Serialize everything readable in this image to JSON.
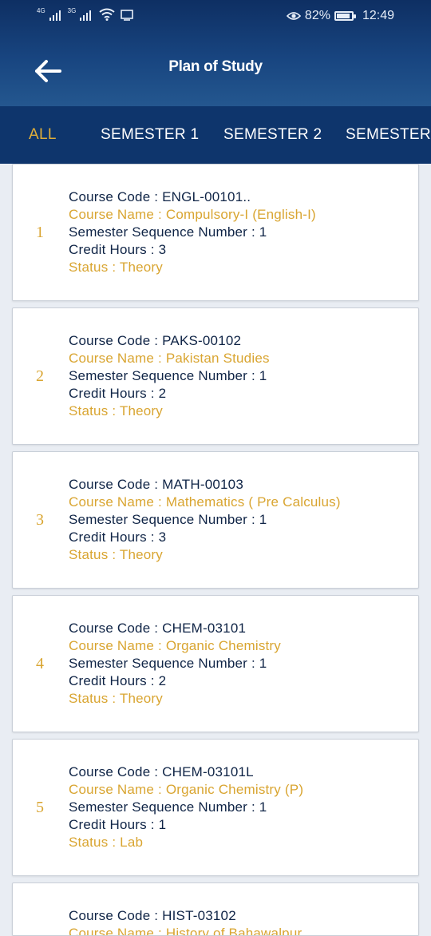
{
  "status_bar": {
    "net1": "4G",
    "net2": "3G",
    "battery": "82%",
    "time": "12:49"
  },
  "header": {
    "title": "Plan of Study"
  },
  "tabs": [
    "ALL",
    "SEMESTER 1",
    "SEMESTER 2",
    "SEMESTER"
  ],
  "colors": {
    "header": "#184580",
    "tabs": "#0e356c",
    "accent": "#d9a531",
    "text": "#0f2446"
  },
  "courses": [
    {
      "index": "1",
      "code": "Course Code : ENGL-00101..",
      "name": "Course Name : Compulsory-I (English-I)",
      "seq": "Semester Sequence Number : 1",
      "credit": "Credit Hours : 3",
      "status": "Status : Theory"
    },
    {
      "index": "2",
      "code": "Course Code : PAKS-00102",
      "name": "Course Name : Pakistan Studies",
      "seq": "Semester Sequence Number : 1",
      "credit": "Credit Hours : 2",
      "status": "Status : Theory"
    },
    {
      "index": "3",
      "code": "Course Code : MATH-00103",
      "name": "Course Name : Mathematics ( Pre Calculus)",
      "seq": "Semester Sequence Number : 1",
      "credit": "Credit Hours : 3",
      "status": "Status : Theory"
    },
    {
      "index": "4",
      "code": "Course Code : CHEM-03101",
      "name": "Course Name : Organic Chemistry",
      "seq": "Semester Sequence Number : 1",
      "credit": "Credit Hours : 2",
      "status": "Status : Theory"
    },
    {
      "index": "5",
      "code": "Course Code : CHEM-03101L",
      "name": "Course Name : Organic Chemistry (P)",
      "seq": "Semester Sequence Number : 1",
      "credit": "Credit Hours : 1",
      "status": "Status : Lab"
    },
    {
      "index": "",
      "code": "Course Code : HIST-03102",
      "name": "Course Name : History of Bahawalpur",
      "seq": "",
      "credit": "",
      "status": ""
    }
  ]
}
